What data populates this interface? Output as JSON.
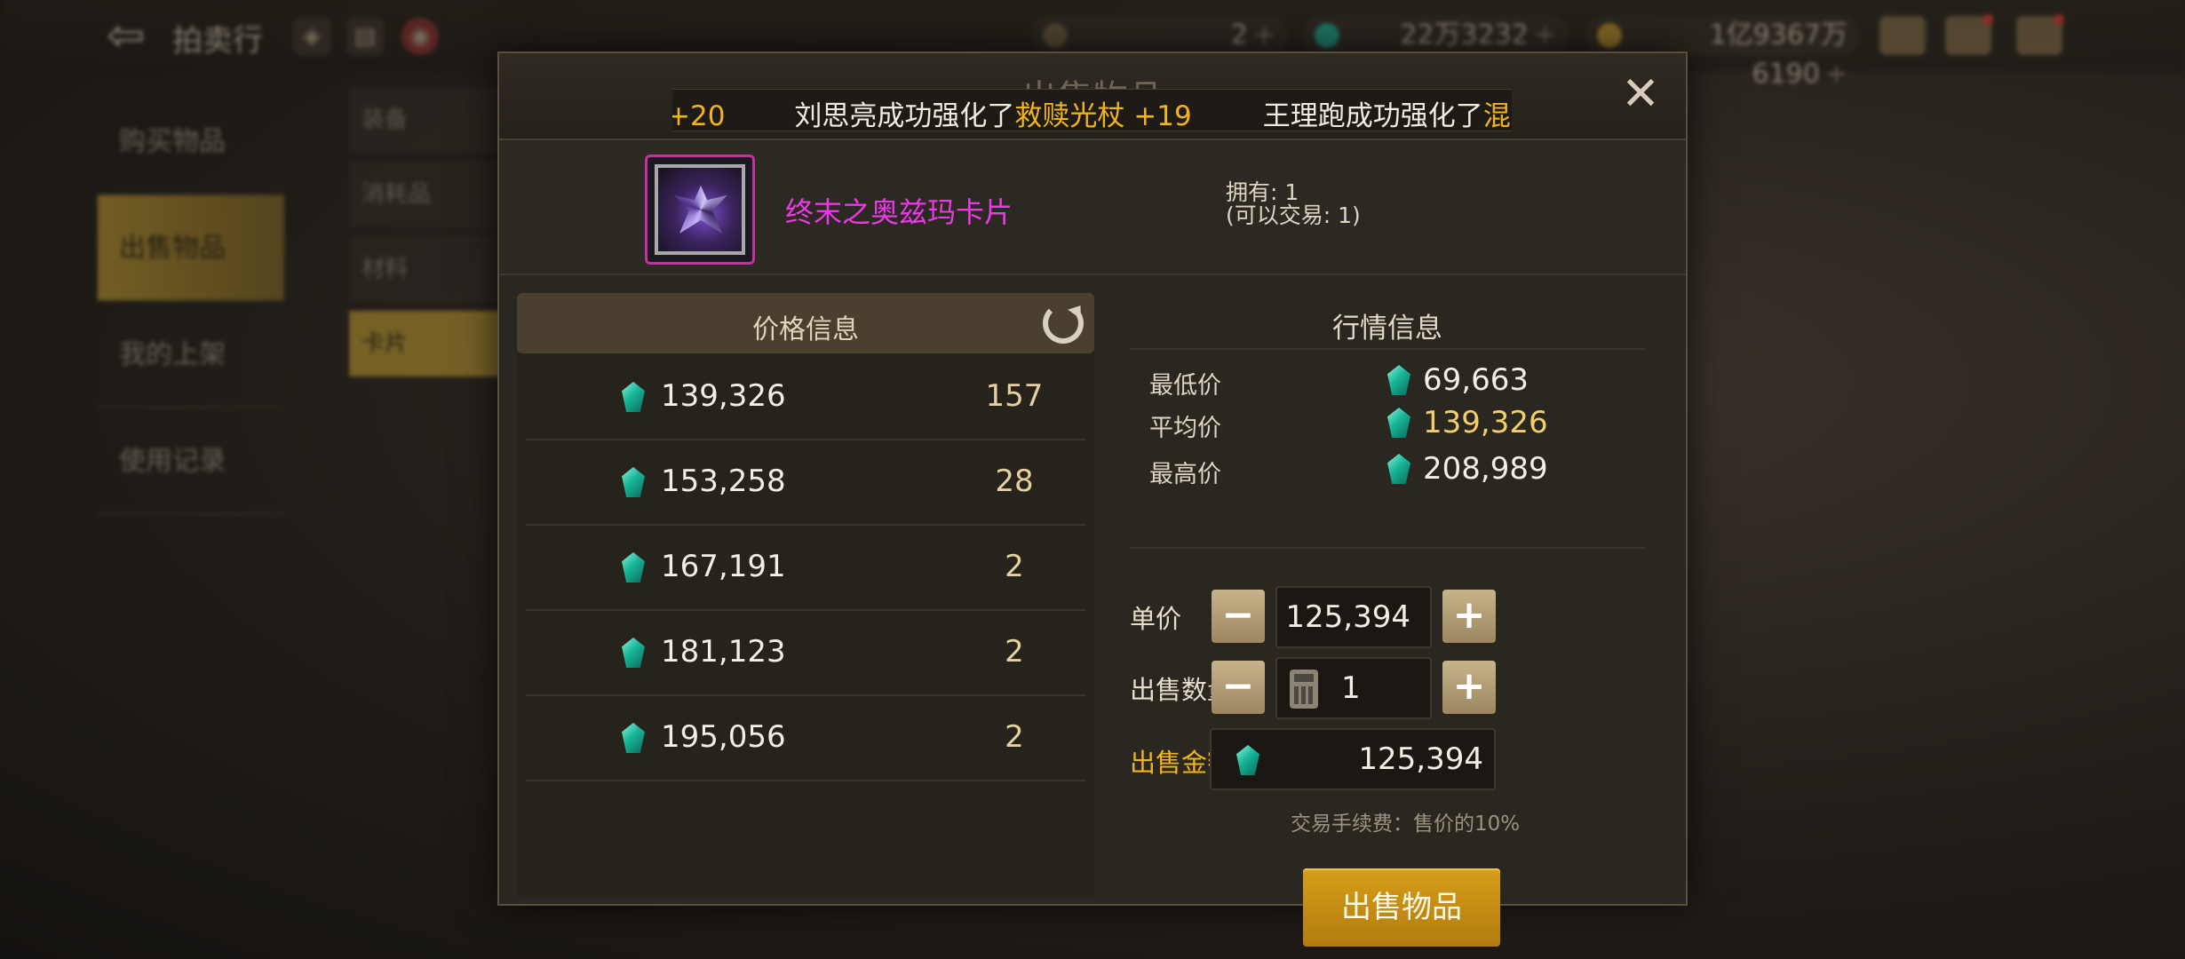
{
  "top_bar": {
    "title": "拍卖行",
    "currencies": [
      {
        "icon": "moon-coin-icon",
        "value": "2",
        "plus": "+"
      },
      {
        "icon": "gem-icon",
        "value": "22万3232",
        "plus": "+"
      },
      {
        "icon": "gold-coin-icon",
        "value": "1亿9367万6190",
        "plus": "+"
      }
    ]
  },
  "sidebar": {
    "items": [
      {
        "label": "购买物品"
      },
      {
        "label": "出售物品"
      },
      {
        "label": "我的上架"
      },
      {
        "label": "使用记录"
      }
    ]
  },
  "subnav": {
    "items": [
      {
        "label": "装备"
      },
      {
        "label": "消耗品"
      },
      {
        "label": "材料"
      },
      {
        "label": "卡片"
      }
    ]
  },
  "modal": {
    "title": "出售物品",
    "ticker": {
      "lead": "+20",
      "msg1_text": "刘思亮成功强化了",
      "msg1_item": "救赎光杖 +19",
      "msg2_text": "王理跑成功强化了",
      "msg2_item": "混沌"
    },
    "item": {
      "name": "终末之奥兹玛卡片",
      "owned": "拥有: 1",
      "tradable": "(可以交易: 1)"
    },
    "price_info": {
      "title": "价格信息",
      "rows": [
        {
          "price": "139,326",
          "count": "157"
        },
        {
          "price": "153,258",
          "count": "28"
        },
        {
          "price": "167,191",
          "count": "2"
        },
        {
          "price": "181,123",
          "count": "2"
        },
        {
          "price": "195,056",
          "count": "2"
        }
      ]
    },
    "market": {
      "title": "行情信息",
      "min_label": "最低价",
      "min_value": "69,663",
      "avg_label": "平均价",
      "avg_value": "139,326",
      "max_label": "最高价",
      "max_value": "208,989"
    },
    "form": {
      "unit_price_label": "单价",
      "unit_price": "125,394",
      "quantity_label": "出售数量",
      "quantity": "1",
      "total_label": "出售金额",
      "total": "125,394",
      "minus": "−",
      "plus": "+",
      "fee_note": "交易手续费：售价的10%",
      "sell_button": "出售物品"
    },
    "close": "✕"
  },
  "colors": {
    "accent_gold": "#f2b41c",
    "item_rarity": "#e93ae6",
    "gem": "#17b59a"
  }
}
